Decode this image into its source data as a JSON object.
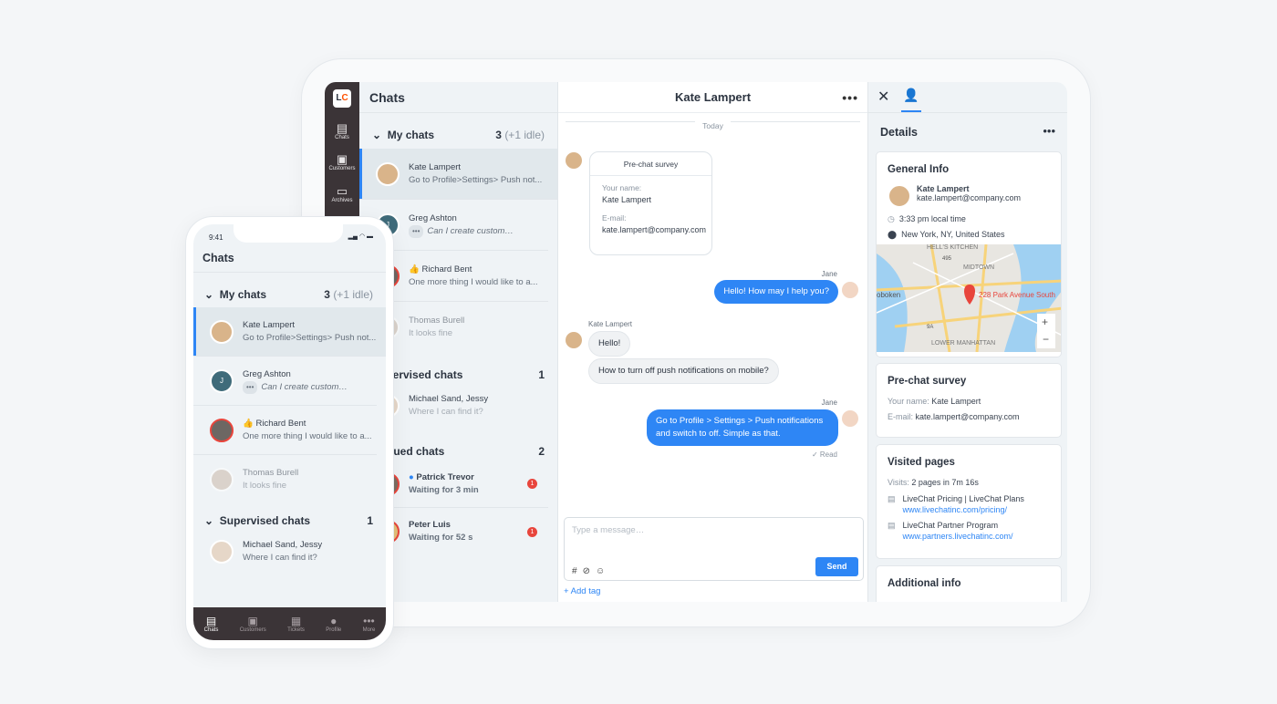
{
  "nav": {
    "logo": "LC",
    "items": [
      {
        "label": "Chats",
        "icon": "chat-bubbles-icon"
      },
      {
        "label": "Customers",
        "icon": "customers-icon"
      },
      {
        "label": "Archives",
        "icon": "archive-icon"
      }
    ]
  },
  "list": {
    "title": "Chats",
    "my_chats": {
      "label": "My chats",
      "count": "3",
      "idle": "(+1 idle)"
    },
    "rows": [
      {
        "name": "Kate Lampert",
        "msg": "Go to Profile>Settings> Push not..."
      },
      {
        "name": "Greg Ashton",
        "initial": "J",
        "typing": "•••",
        "msg": "Can I create custom…"
      },
      {
        "name": "Richard Bent",
        "msg": "One more thing I would like to a..."
      },
      {
        "name": "Thomas Burell",
        "msg": "It looks fine"
      }
    ],
    "supervised": {
      "label": "Supervised chats",
      "count": "1",
      "rows": [
        {
          "name": "Michael Sand, Jessy",
          "msg": "Where I can find it?"
        }
      ]
    },
    "queued": {
      "label": "Queued chats",
      "count": "2",
      "rows": [
        {
          "name": "Patrick Trevor",
          "msg": "Waiting for 3 min",
          "badge": "1"
        },
        {
          "name": "Peter Luis",
          "msg": "Waiting for 52 s",
          "badge": "1"
        }
      ]
    }
  },
  "chat": {
    "title": "Kate Lampert",
    "today": "Today",
    "survey": {
      "title": "Pre-chat survey",
      "name_label": "Your name:",
      "name": "Kate Lampert",
      "email_label": "E-mail:",
      "email": "kate.lampert@company.com"
    },
    "messages": [
      {
        "sender": "Jane",
        "text": "Hello! How may I help you?"
      },
      {
        "sender": "Kate Lampert",
        "text": "Hello!"
      },
      {
        "text": "How to turn off push notifications on mobile?"
      },
      {
        "sender": "Jane",
        "text": "Go to Profile > Settings > Push notifications and switch to off. Simple as that."
      }
    ],
    "read": "✓ Read",
    "input_placeholder": "Type a message…",
    "send": "Send",
    "add_tag": "+ Add tag"
  },
  "details": {
    "title": "Details",
    "general": {
      "title": "General Info",
      "name": "Kate Lampert",
      "email": "kate.lampert@company.com",
      "time": "3:33 pm local time",
      "location": "New York, NY, United States",
      "map_label": "228 Park Avenue South",
      "map_places": [
        "HELL'S KITCHEN",
        "MIDTOWN",
        "oboken",
        "LOWER MANHATTAN",
        "495",
        "9A"
      ]
    },
    "survey": {
      "title": "Pre-chat survey",
      "name_label": "Your name:",
      "name": "Kate Lampert",
      "email_label": "E-mail:",
      "email": "kate.lampert@company.com"
    },
    "visited": {
      "title": "Visited pages",
      "visits_label": "Visits:",
      "visits": "2 pages in 7m 16s",
      "pages": [
        {
          "title": "LiveChat Pricing | LiveChat Plans",
          "url": "www.livechatinc.com/pricing/"
        },
        {
          "title": "LiveChat Partner Program",
          "url": "www.partners.livechatinc.com/"
        }
      ]
    },
    "additional": {
      "title": "Additional info"
    }
  },
  "phone": {
    "time": "9:41",
    "title": "Chats",
    "bottom_nav": [
      "Chats",
      "Customers",
      "Tickets",
      "Profile",
      "More"
    ]
  },
  "colors": {
    "accent": "#2e86f5",
    "nav": "#3b3437",
    "alert": "#e8453c",
    "brand": "#ff5100"
  }
}
